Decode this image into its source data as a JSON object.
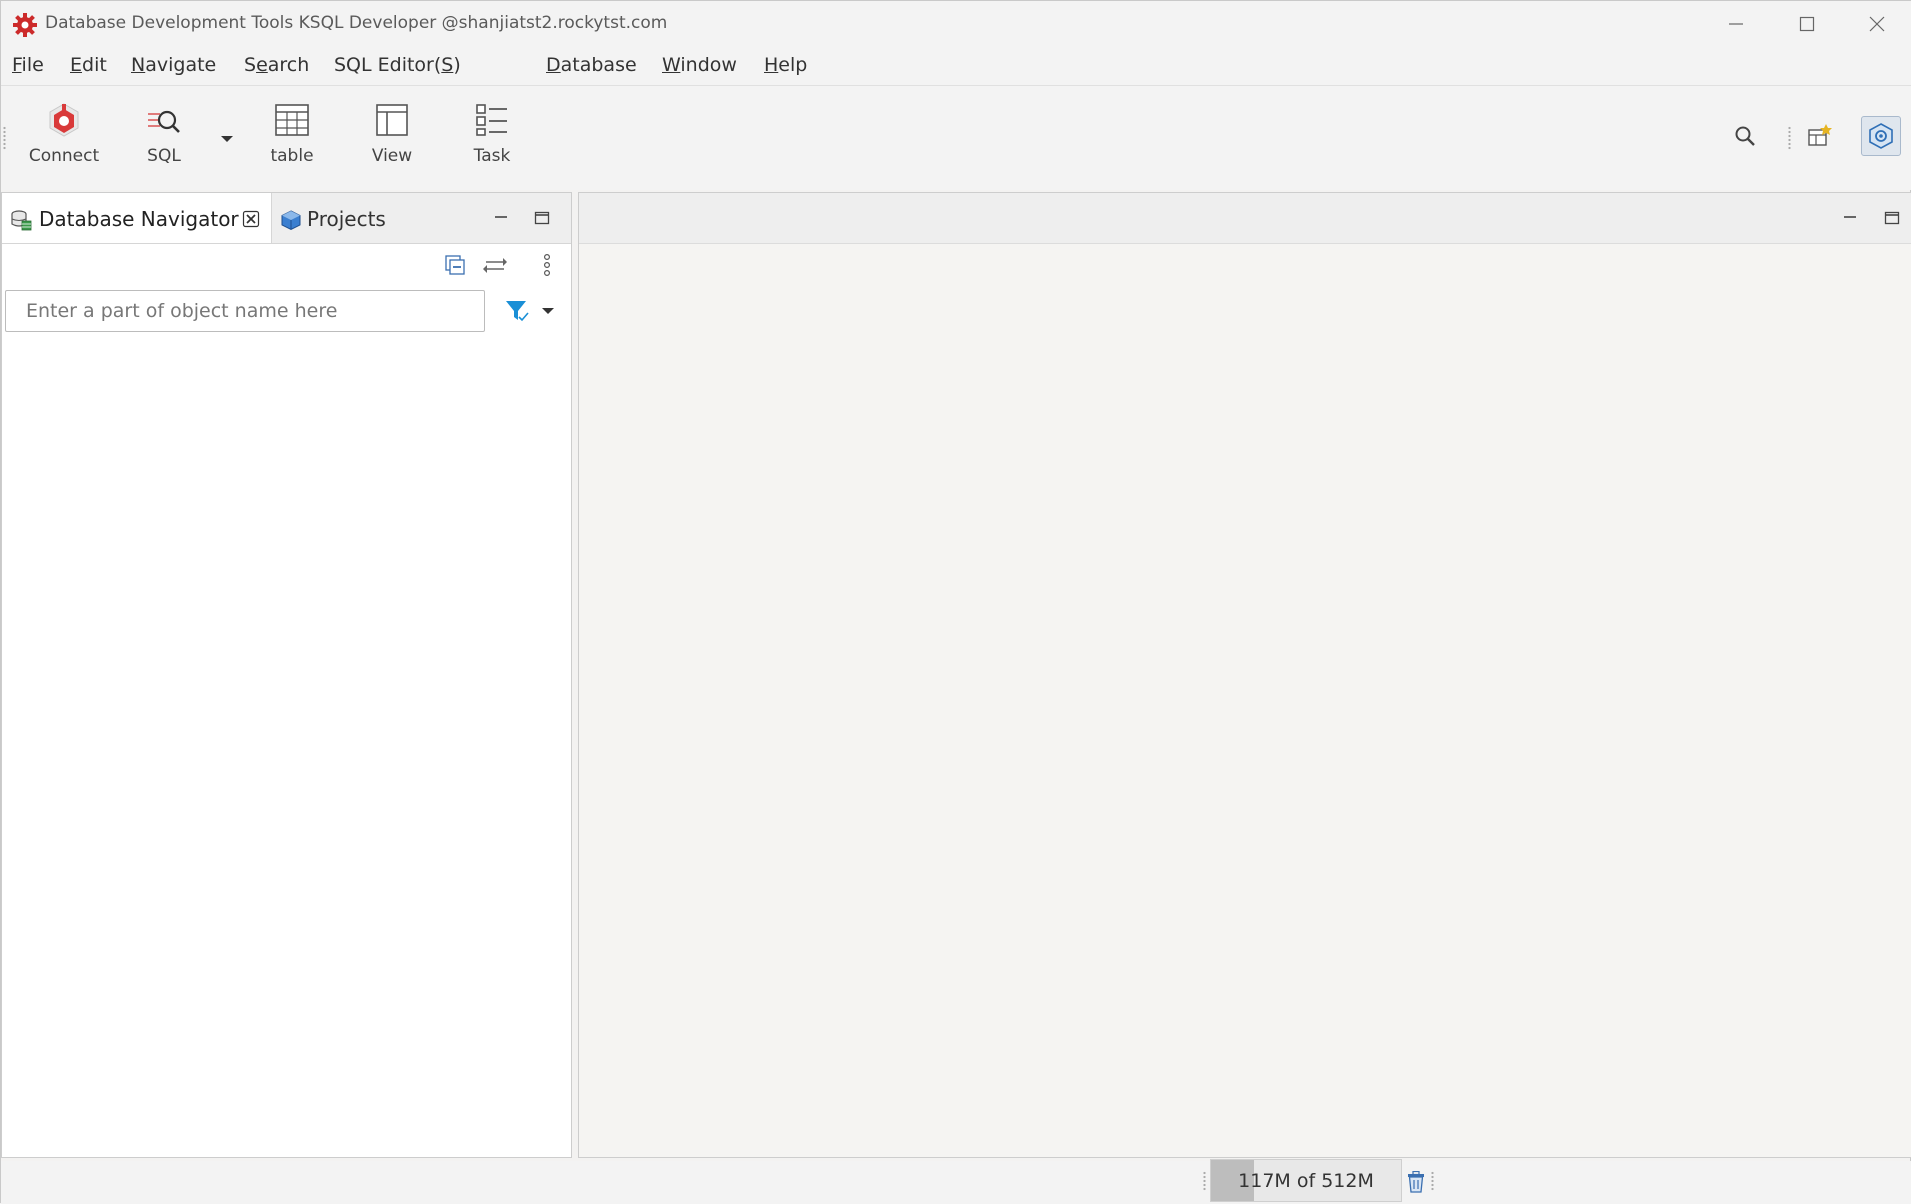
{
  "window": {
    "title": "Database Development Tools KSQL Developer @shanjiatst2.rockytst.com"
  },
  "menu": [
    {
      "label": "File",
      "mnemonic_index": 0
    },
    {
      "label": "Edit",
      "mnemonic_index": 0
    },
    {
      "label": "Navigate",
      "mnemonic_index": 0
    },
    {
      "label": "Search",
      "mnemonic_index": 1
    },
    {
      "label": "SQL Editor(S)",
      "mnemonic_index": 11
    },
    {
      "label": "Database",
      "mnemonic_index": 0
    },
    {
      "label": "Window",
      "mnemonic_index": 0
    },
    {
      "label": "Help",
      "mnemonic_index": 0
    }
  ],
  "toolbar": {
    "connect_label": "Connect",
    "sql_label": "SQL",
    "table_label": "table",
    "view_label": "View",
    "task_label": "Task"
  },
  "left_panel": {
    "tabs": [
      {
        "label": "Database Navigator",
        "active": true,
        "icon": "database-navigator-icon"
      },
      {
        "label": "Projects",
        "active": false,
        "icon": "projects-icon"
      }
    ],
    "search_placeholder": "Enter a part of object name here",
    "search_value": ""
  },
  "status": {
    "memory_text": "117M of 512M",
    "memory_used_fraction": 0.2285
  },
  "colors": {
    "accent": "#cc2a2a",
    "filter_blue": "#1a8fd6",
    "icon_blue": "#2f6fb6"
  }
}
